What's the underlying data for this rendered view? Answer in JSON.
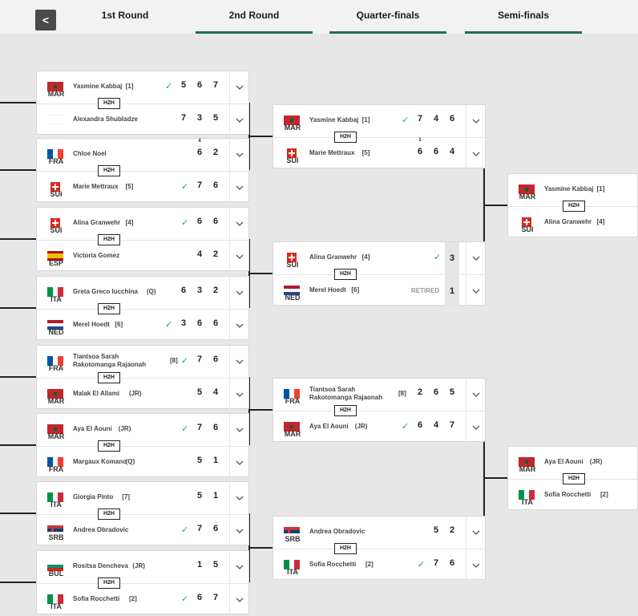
{
  "nav": {
    "back_label": "<",
    "tabs": [
      {
        "label": "1st Round",
        "active": false
      },
      {
        "label": "2nd Round",
        "active": true
      },
      {
        "label": "Quarter-finals",
        "active": true
      },
      {
        "label": "Semi-finals",
        "active": true
      }
    ]
  },
  "colors": {
    "accent": "#1f6f54",
    "win": "#2aa34a"
  },
  "h2h_label": "H2H",
  "matches": [
    {
      "round": 0,
      "players": [
        {
          "code": "MAR",
          "flag": "morocco",
          "name": "Yasmine Kabbaj",
          "seed": "[1]",
          "winner": true,
          "scores": [
            "5",
            "6",
            "7"
          ],
          "tb": [
            "",
            "",
            ""
          ]
        },
        {
          "code": "",
          "flag": "none",
          "name": "Alexandra Shubladze",
          "seed": "",
          "winner": false,
          "scores": [
            "7",
            "3",
            "5"
          ],
          "tb": [
            "",
            "",
            ""
          ]
        }
      ]
    },
    {
      "round": 0,
      "players": [
        {
          "code": "FRA",
          "flag": "france",
          "name": "Chloe Noel",
          "seed": "",
          "winner": false,
          "scores": [
            "6",
            "2"
          ],
          "tb": [
            "4",
            ""
          ]
        },
        {
          "code": "SUI",
          "flag": "switzerland",
          "name": "Marie Mettraux",
          "seed": "[5]",
          "winner": true,
          "scores": [
            "7",
            "6"
          ],
          "tb": [
            "",
            ""
          ]
        }
      ]
    },
    {
      "round": 0,
      "players": [
        {
          "code": "SUI",
          "flag": "switzerland",
          "name": "Alina Granwehr",
          "seed": "[4]",
          "winner": true,
          "scores": [
            "6",
            "6"
          ],
          "tb": [
            "",
            ""
          ]
        },
        {
          "code": "ESP",
          "flag": "spain",
          "name": "Victoria Gomez",
          "seed": "",
          "winner": false,
          "scores": [
            "4",
            "2"
          ],
          "tb": [
            "",
            ""
          ]
        }
      ]
    },
    {
      "round": 0,
      "players": [
        {
          "code": "ITA",
          "flag": "italy",
          "name": "Greta Greco lucchina",
          "seed": "(Q)",
          "winner": false,
          "scores": [
            "6",
            "3",
            "2"
          ],
          "tb": [
            "",
            "",
            ""
          ]
        },
        {
          "code": "NED",
          "flag": "netherlands",
          "name": "Merel Hoedt",
          "seed": "[6]",
          "winner": true,
          "scores": [
            "3",
            "6",
            "6"
          ],
          "tb": [
            "",
            "",
            ""
          ]
        }
      ]
    },
    {
      "round": 0,
      "players": [
        {
          "code": "FRA",
          "flag": "france",
          "name": "Tiantsoa Sarah Rakotomanga Rajaonah",
          "seed": "[8]",
          "winner": true,
          "scores": [
            "7",
            "6"
          ],
          "tb": [
            "",
            ""
          ]
        },
        {
          "code": "MAR",
          "flag": "morocco",
          "name": "Malak El Allami",
          "seed": "(JR)",
          "winner": false,
          "scores": [
            "5",
            "4"
          ],
          "tb": [
            "",
            ""
          ]
        }
      ]
    },
    {
      "round": 0,
      "players": [
        {
          "code": "MAR",
          "flag": "morocco",
          "name": "Aya El Aouni",
          "seed": "(JR)",
          "winner": true,
          "scores": [
            "7",
            "6"
          ],
          "tb": [
            "",
            ""
          ]
        },
        {
          "code": "FRA",
          "flag": "france",
          "name": "Margaux Komano",
          "seed": "(Q)",
          "winner": false,
          "scores": [
            "5",
            "1"
          ],
          "tb": [
            "",
            ""
          ]
        }
      ]
    },
    {
      "round": 0,
      "players": [
        {
          "code": "ITA",
          "flag": "italy",
          "name": "Giorgia Pinto",
          "seed": "[7]",
          "winner": false,
          "scores": [
            "5",
            "1"
          ],
          "tb": [
            "",
            ""
          ]
        },
        {
          "code": "SRB",
          "flag": "serbia",
          "name": "Andrea Obradovic",
          "seed": "",
          "winner": true,
          "scores": [
            "7",
            "6"
          ],
          "tb": [
            "",
            ""
          ]
        }
      ]
    },
    {
      "round": 0,
      "players": [
        {
          "code": "BUL",
          "flag": "bulgaria",
          "name": "Rositsa Dencheva",
          "seed": "(JR)",
          "winner": false,
          "scores": [
            "1",
            "5"
          ],
          "tb": [
            "",
            ""
          ]
        },
        {
          "code": "ITA",
          "flag": "italy",
          "name": "Sofia Rocchetti",
          "seed": "[2]",
          "winner": true,
          "scores": [
            "6",
            "7"
          ],
          "tb": [
            "",
            ""
          ]
        }
      ]
    },
    {
      "round": 1,
      "players": [
        {
          "code": "MAR",
          "flag": "morocco",
          "name": "Yasmine Kabbaj",
          "seed": "[1]",
          "winner": true,
          "scores": [
            "7",
            "4",
            "6"
          ],
          "tb": [
            "",
            "",
            ""
          ]
        },
        {
          "code": "SUI",
          "flag": "switzerland",
          "name": "Marie Mettraux",
          "seed": "[5]",
          "winner": false,
          "scores": [
            "6",
            "6",
            "4"
          ],
          "tb": [
            "1",
            "",
            ""
          ]
        }
      ]
    },
    {
      "round": 1,
      "players": [
        {
          "code": "SUI",
          "flag": "switzerland",
          "name": "Alina Granwehr",
          "seed": "[4]",
          "winner": true,
          "scores": [
            "3"
          ],
          "tb": [
            ""
          ]
        },
        {
          "code": "NED",
          "flag": "netherlands",
          "name": "Merel Hoedt",
          "seed": "[6]",
          "winner": false,
          "status": "RETIRED",
          "scores": [
            "1"
          ],
          "tb": [
            ""
          ]
        }
      ]
    },
    {
      "round": 1,
      "players": [
        {
          "code": "FRA",
          "flag": "france",
          "name": "Tiantsoa Sarah Rakotomanga Rajaonah",
          "seed": "[8]",
          "winner": false,
          "scores": [
            "2",
            "6",
            "5"
          ],
          "tb": [
            "",
            "",
            ""
          ]
        },
        {
          "code": "MAR",
          "flag": "morocco",
          "name": "Aya El Aouni",
          "seed": "(JR)",
          "winner": true,
          "scores": [
            "6",
            "4",
            "7"
          ],
          "tb": [
            "",
            "",
            ""
          ]
        }
      ]
    },
    {
      "round": 1,
      "players": [
        {
          "code": "SRB",
          "flag": "serbia",
          "name": "Andrea Obradovic",
          "seed": "",
          "winner": false,
          "scores": [
            "5",
            "2"
          ],
          "tb": [
            "",
            ""
          ]
        },
        {
          "code": "ITA",
          "flag": "italy",
          "name": "Sofia Rocchetti",
          "seed": "[2]",
          "winner": true,
          "scores": [
            "7",
            "6"
          ],
          "tb": [
            "",
            ""
          ]
        }
      ]
    },
    {
      "round": 2,
      "players": [
        {
          "code": "MAR",
          "flag": "morocco",
          "name": "Yasmine Kabbaj",
          "seed": "[1]",
          "winner": false,
          "scores": [],
          "tb": []
        },
        {
          "code": "SUI",
          "flag": "switzerland",
          "name": "Alina Granwehr",
          "seed": "[4]",
          "winner": false,
          "scores": [],
          "tb": []
        }
      ]
    },
    {
      "round": 2,
      "players": [
        {
          "code": "MAR",
          "flag": "morocco",
          "name": "Aya El Aouni",
          "seed": "(JR)",
          "winner": false,
          "scores": [],
          "tb": []
        },
        {
          "code": "ITA",
          "flag": "italy",
          "name": "Sofia Rocchetti",
          "seed": "[2]",
          "winner": false,
          "scores": [],
          "tb": []
        }
      ]
    }
  ]
}
